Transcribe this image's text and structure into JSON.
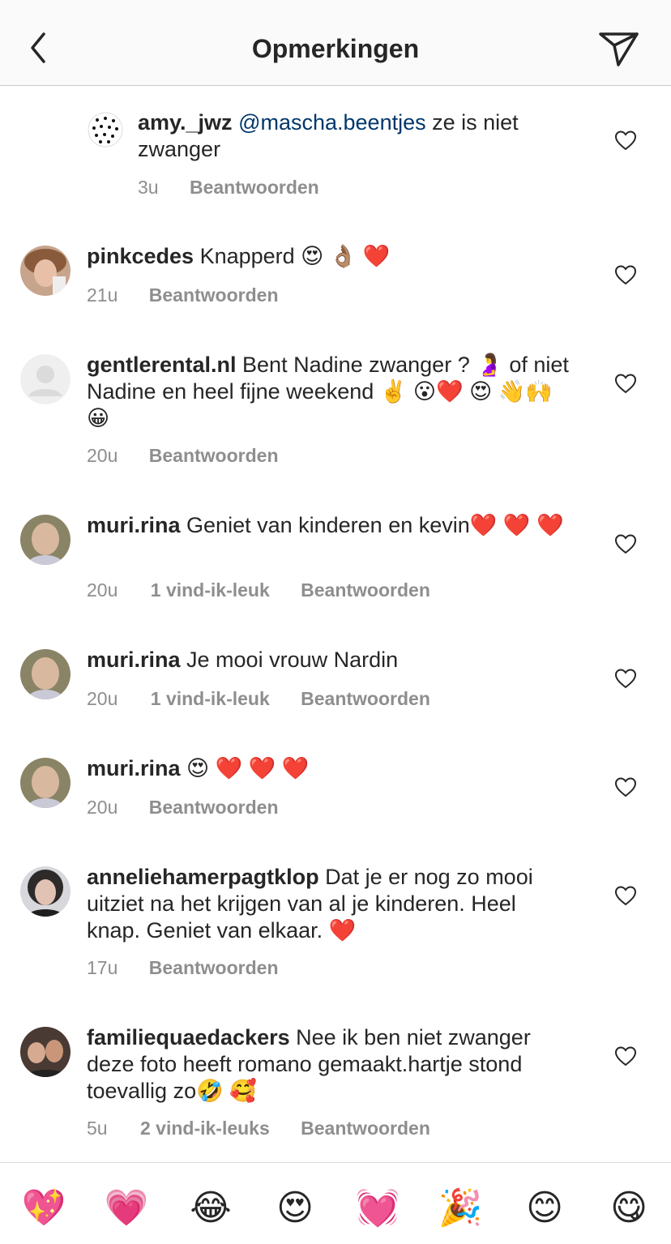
{
  "header": {
    "title": "Opmerkingen"
  },
  "comments": [
    {
      "username": "amy._jwz",
      "mention": "@mascha.beentjes",
      "text": " ze is niet zwanger",
      "time": "3u",
      "likes": "",
      "reply": "Beantwoorden"
    },
    {
      "username": "pinkcedes",
      "text": " Knapperd 😍 👌🏽 ❤️",
      "time": "21u",
      "likes": "",
      "reply": "Beantwoorden"
    },
    {
      "username": "gentlerental.nl",
      "text": " Bent Nadine zwanger ? 🤰 of niet Nadine en heel fijne weekend ✌️ 😮❤️ 😍 👋🙌😀",
      "time": "20u",
      "likes": "",
      "reply": "Beantwoorden"
    },
    {
      "username": "muri.rina",
      "text": " Geniet van kinderen en kevin❤️ ❤️ ❤️",
      "time": "20u",
      "likes": "1 vind-ik-leuk",
      "reply": "Beantwoorden"
    },
    {
      "username": "muri.rina",
      "text": " Je mooi vrouw Nardin",
      "time": "20u",
      "likes": "1 vind-ik-leuk",
      "reply": "Beantwoorden"
    },
    {
      "username": "muri.rina",
      "text": " 😍 ❤️ ❤️ ❤️",
      "time": "20u",
      "likes": "",
      "reply": "Beantwoorden"
    },
    {
      "username": "anneliehamerpagtklop",
      "text": " Dat je er nog zo mooi uitziet na het krijgen van al je kinderen. Heel knap. Geniet van elkaar. ❤️",
      "time": "17u",
      "likes": "",
      "reply": "Beantwoorden"
    },
    {
      "username": "familiequaedackers",
      "text": " Nee ik ben niet zwanger deze foto heeft romano gemaakt.hartje stond toevallig zo🤣 🥰",
      "time": "5u",
      "likes": "2 vind-ik-leuks",
      "reply": "Beantwoorden"
    }
  ],
  "emoji_bar": [
    "💖",
    "💗",
    "😂",
    "😍",
    "💓",
    "🎉",
    "😊",
    "😋"
  ],
  "colors": {
    "text": "#262626",
    "meta": "#8e8e8e",
    "mention": "#00376b"
  }
}
